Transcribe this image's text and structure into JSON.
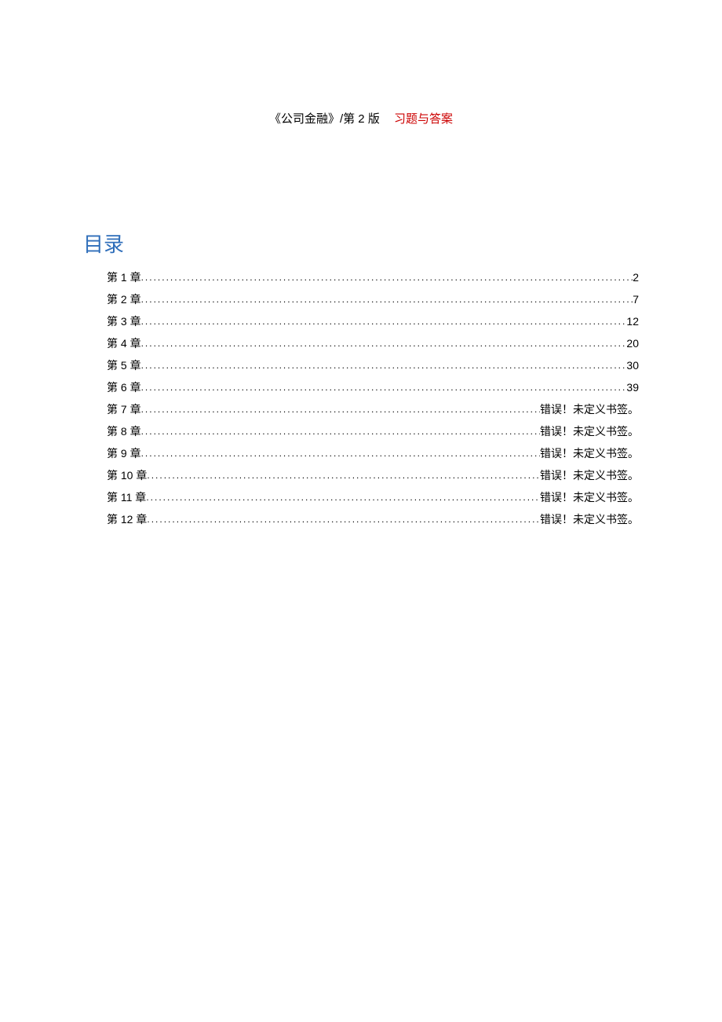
{
  "header": {
    "title_black": "《公司金融》/第 2 版",
    "title_red": "习题与答案"
  },
  "toc": {
    "heading": "目录",
    "entries": [
      {
        "label": "第 1 章",
        "page": "2"
      },
      {
        "label": "第 2 章",
        "page": "7"
      },
      {
        "label": "第 3 章",
        "page": "12"
      },
      {
        "label": "第 4 章",
        "page": "20"
      },
      {
        "label": "第 5 章",
        "page": "30"
      },
      {
        "label": "第 6 章",
        "page": "39"
      },
      {
        "label": "第 7 章",
        "page": "错误！未定义书签。"
      },
      {
        "label": "第 8 章",
        "page": "错误！未定义书签。"
      },
      {
        "label": "第 9 章",
        "page": "错误！未定义书签。"
      },
      {
        "label": "第 10 章",
        "page": "错误！未定义书签。"
      },
      {
        "label": "第 11 章",
        "page": "错误！未定义书签。"
      },
      {
        "label": "第 12 章",
        "page": "错误！未定义书签。"
      }
    ]
  }
}
